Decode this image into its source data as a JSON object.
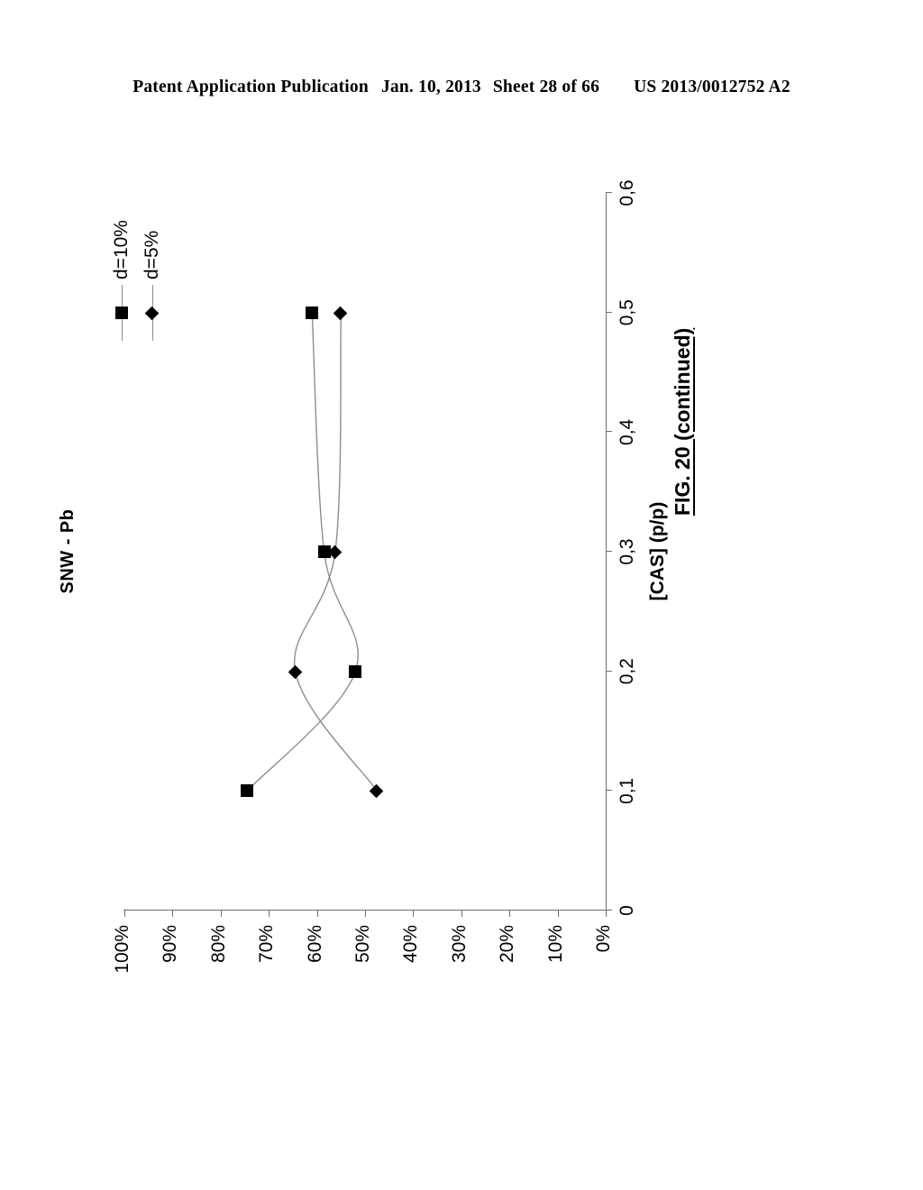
{
  "header": {
    "publication": "Patent Application Publication",
    "date": "Jan. 10, 2013",
    "sheet": "Sheet 28 of 66",
    "number": "US 2013/0012752 A2"
  },
  "figure": {
    "caption": "FIG. 20 (continued)"
  },
  "legend": {
    "items": [
      {
        "label": "d=10%",
        "marker": "square-marker"
      },
      {
        "label": "d=5%",
        "marker": "diamond-marker"
      }
    ]
  },
  "axes": {
    "x_ticks": [
      "0",
      "0,1",
      "0,2",
      "0,3",
      "0,4",
      "0,5",
      "0,6"
    ],
    "y_ticks": [
      "0%",
      "10%",
      "20%",
      "30%",
      "40%",
      "50%",
      "60%",
      "70%",
      "80%",
      "90%",
      "100%"
    ]
  },
  "chart_data": {
    "type": "line",
    "title": "SNW - Pb",
    "xlabel": "[CAS] (p/p)",
    "ylabel": "",
    "xlim": [
      0,
      0.6
    ],
    "ylim": [
      0,
      1
    ],
    "xtick_values": [
      0,
      0.1,
      0.2,
      0.3,
      0.4,
      0.5,
      0.6
    ],
    "xtick_labels": [
      "0",
      "0,1",
      "0,2",
      "0,3",
      "0,4",
      "0,5",
      "0,6"
    ],
    "ytick_values": [
      0,
      0.1,
      0.2,
      0.3,
      0.4,
      0.5,
      0.6,
      0.7,
      0.8,
      0.9,
      1.0
    ],
    "ytick_labels": [
      "0%",
      "10%",
      "20%",
      "30%",
      "40%",
      "50%",
      "60%",
      "70%",
      "80%",
      "90%",
      "100%"
    ],
    "grid": false,
    "legend_position": "top-right",
    "x": [
      0.1,
      0.2,
      0.3,
      0.5
    ],
    "series": [
      {
        "name": "d=10%",
        "marker": "square",
        "values": [
          0.745,
          0.52,
          0.585,
          0.61
        ]
      },
      {
        "name": "d=5%",
        "marker": "diamond",
        "values": [
          0.475,
          0.645,
          0.562,
          0.55
        ]
      }
    ]
  }
}
